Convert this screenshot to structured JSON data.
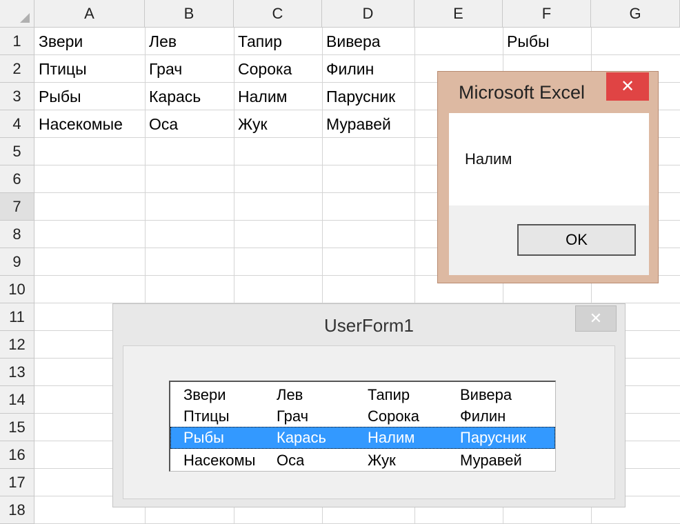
{
  "columns": [
    "A",
    "B",
    "C",
    "D",
    "E",
    "F",
    "G"
  ],
  "rows": [
    "1",
    "2",
    "3",
    "4",
    "5",
    "6",
    "7",
    "8",
    "9",
    "10",
    "11",
    "12",
    "13",
    "14",
    "15",
    "16",
    "17",
    "18"
  ],
  "cells": {
    "A1": "Звери",
    "B1": "Лев",
    "C1": "Тапир",
    "D1": "Вивера",
    "F1": "Рыбы",
    "A2": "Птицы",
    "B2": "Грач",
    "C2": "Сорока",
    "D2": "Филин",
    "A3": "Рыбы",
    "B3": "Карась",
    "C3": "Налим",
    "D3": "Парусник",
    "A4": "Насекомые",
    "B4": "Оса",
    "C4": "Жук",
    "D4": "Муравей"
  },
  "msgbox": {
    "title": "Microsoft Excel",
    "close_glyph": "✕",
    "message": "Налим",
    "ok_label": "OK"
  },
  "userform": {
    "title": "UserForm1",
    "close_glyph": "✕",
    "listbox": {
      "selected_index": 2,
      "items": [
        [
          "Звери",
          "Лев",
          "Тапир",
          "Вивера"
        ],
        [
          "Птицы",
          "Грач",
          "Сорока",
          "Филин"
        ],
        [
          "Рыбы",
          "Карась",
          "Налим",
          "Парусник"
        ],
        [
          "Насекомы",
          "Оса",
          "Жук",
          "Муравей"
        ]
      ]
    }
  },
  "selected_row_header": "7",
  "colors": {
    "msgbox_frame": "#ddb9a2",
    "close_red": "#e04444",
    "selection_blue": "#3399ff"
  }
}
